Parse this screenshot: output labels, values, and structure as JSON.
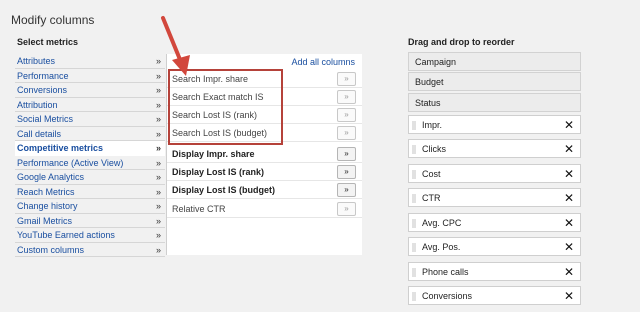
{
  "page": {
    "title": "Modify columns"
  },
  "select_metrics": {
    "heading": "Select metrics",
    "categories": [
      {
        "label": "Attributes",
        "active": false
      },
      {
        "label": "Performance",
        "active": false
      },
      {
        "label": "Conversions",
        "active": false
      },
      {
        "label": "Attribution",
        "active": false
      },
      {
        "label": "Social Metrics",
        "active": false
      },
      {
        "label": "Call details",
        "active": false
      },
      {
        "label": "Competitive metrics",
        "active": true
      },
      {
        "label": "Performance (Active View)",
        "active": false
      },
      {
        "label": "Google Analytics",
        "active": false
      },
      {
        "label": "Reach Metrics",
        "active": false
      },
      {
        "label": "Change history",
        "active": false
      },
      {
        "label": "Gmail Metrics",
        "active": false
      },
      {
        "label": "YouTube Earned actions",
        "active": false
      },
      {
        "label": "Custom columns",
        "active": false
      }
    ],
    "chevron": "»"
  },
  "metrics_panel": {
    "add_all_label": "Add all columns",
    "add_button_label": "»",
    "metrics": [
      {
        "label": "Search Impr. share",
        "added": true,
        "highlighted": true
      },
      {
        "label": "Search Exact match IS",
        "added": true,
        "highlighted": true
      },
      {
        "label": "Search Lost IS (rank)",
        "added": true,
        "highlighted": true
      },
      {
        "label": "Search Lost IS (budget)",
        "added": true,
        "highlighted": true
      },
      {
        "label": "Display Impr. share",
        "added": false,
        "highlighted": false
      },
      {
        "label": "Display Lost IS (rank)",
        "added": false,
        "highlighted": false
      },
      {
        "label": "Display Lost IS (budget)",
        "added": false,
        "highlighted": false
      },
      {
        "label": "Relative CTR",
        "added": true,
        "highlighted": false
      }
    ]
  },
  "reorder": {
    "heading": "Drag and drop to reorder",
    "fixed_columns": [
      "Campaign",
      "Budget",
      "Status"
    ],
    "columns": [
      "Impr.",
      "Clicks",
      "Cost",
      "CTR",
      "Avg. CPC",
      "Avg. Pos.",
      "Phone calls",
      "Conversions"
    ],
    "remove_label": "✕"
  },
  "colors": {
    "link": "#1a4fa0",
    "highlight_box": "#b5423a",
    "arrow": "#d2473c"
  }
}
